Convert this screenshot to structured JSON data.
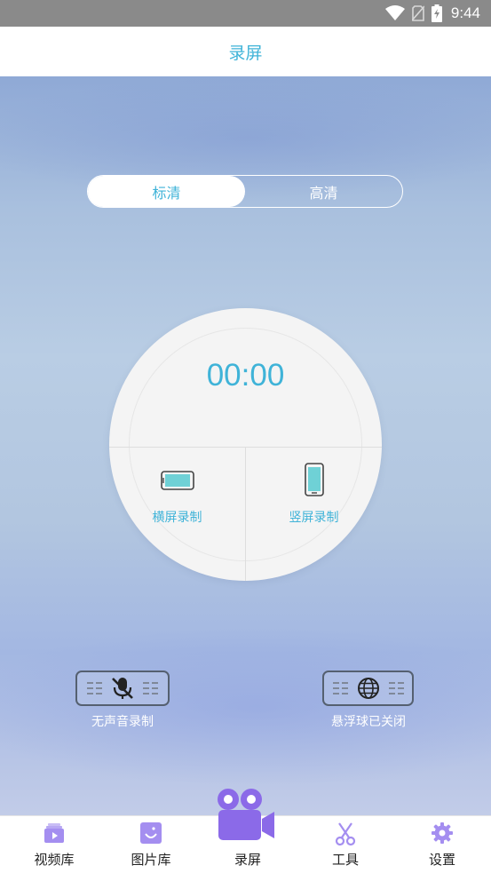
{
  "status_bar": {
    "time": "9:44"
  },
  "header": {
    "title": "录屏"
  },
  "quality": {
    "options": [
      "标清",
      "高清"
    ],
    "selected": "标清"
  },
  "recorder": {
    "timer": "00:00",
    "landscape_label": "横屏录制",
    "portrait_label": "竖屏录制"
  },
  "options": {
    "mute_label": "无声音录制",
    "float_label": "悬浮球已关闭"
  },
  "nav": {
    "items": [
      {
        "label": "视频库",
        "icon": "video-library-icon"
      },
      {
        "label": "图片库",
        "icon": "image-library-icon"
      },
      {
        "label": "录屏",
        "icon": "video-camera-icon"
      },
      {
        "label": "工具",
        "icon": "scissors-icon"
      },
      {
        "label": "设置",
        "icon": "gear-icon"
      }
    ],
    "active_index": 2
  },
  "colors": {
    "accent": "#3fb3d8",
    "nav_icon": "#a48ef0",
    "camera": "#8b6ae8",
    "status_bar": "#8a8a8a"
  }
}
